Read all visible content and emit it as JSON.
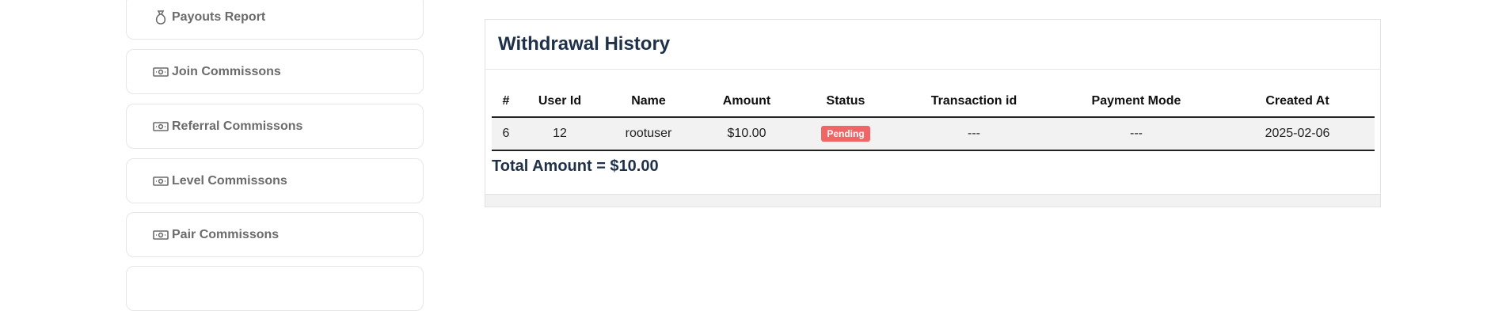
{
  "sidebar": {
    "items": [
      {
        "label": "Payouts Report",
        "icon": "money-bag-icon"
      },
      {
        "label": "Join Commissons",
        "icon": "cash-icon"
      },
      {
        "label": "Referral Commissons",
        "icon": "cash-icon"
      },
      {
        "label": "Level Commissons",
        "icon": "cash-icon"
      },
      {
        "label": "Pair Commissons",
        "icon": "cash-icon"
      }
    ]
  },
  "withdrawal": {
    "title": "Withdrawal History",
    "headers": [
      "#",
      "User Id",
      "Name",
      "Amount",
      "Status",
      "Transaction id",
      "Payment Mode",
      "Created At"
    ],
    "rows": [
      {
        "idx": "6",
        "user_id": "12",
        "name": "rootuser",
        "amount": "$10.00",
        "status": "Pending",
        "transaction_id": "---",
        "payment_mode": "---",
        "created_at": "2025-02-06"
      }
    ],
    "total": "Total Amount = $10.00"
  },
  "colors": {
    "heading": "#1f3149",
    "badge_pending": "#f06565",
    "sidebar_text": "#6b6b6b"
  }
}
